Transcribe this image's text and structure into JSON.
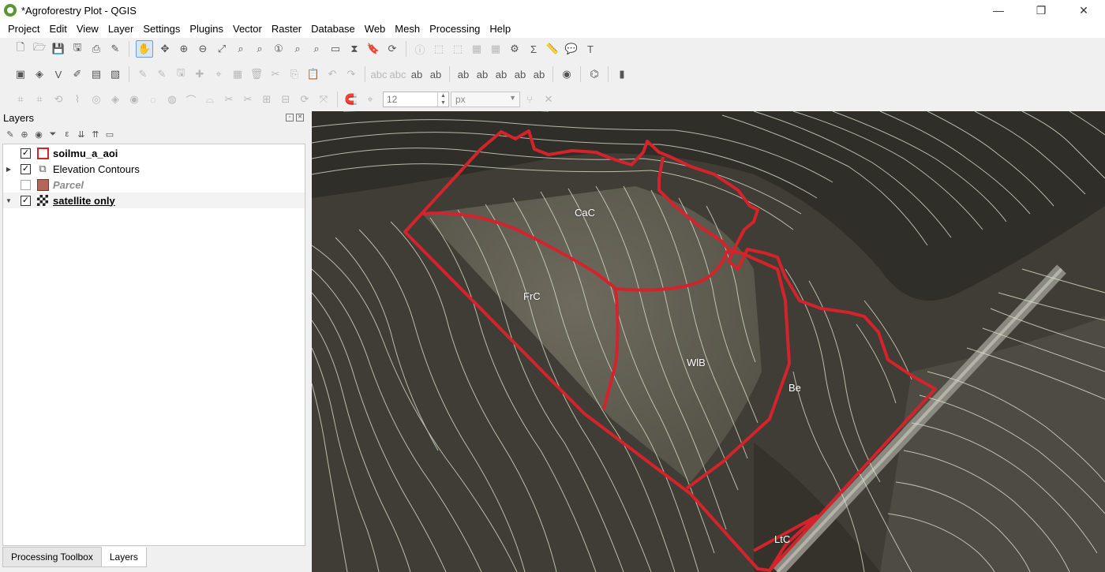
{
  "window": {
    "title": "*Agroforestry Plot - QGIS",
    "minimize": "—",
    "maximize": "❐",
    "close": "✕"
  },
  "menu": [
    "Project",
    "Edit",
    "View",
    "Layer",
    "Settings",
    "Plugins",
    "Vector",
    "Raster",
    "Database",
    "Web",
    "Mesh",
    "Processing",
    "Help"
  ],
  "snapping": {
    "tolerance": "12",
    "units": "px"
  },
  "layers_panel": {
    "title": "Layers",
    "layers": [
      {
        "name": "soilmu_a_aoi",
        "checked": true,
        "style": "bold",
        "symbol": "polygon-red-outline",
        "expandable": false
      },
      {
        "name": "Elevation Contours",
        "checked": true,
        "style": "normal",
        "symbol": "contour-lines",
        "expandable": true,
        "expanded": false
      },
      {
        "name": "Parcel",
        "checked": false,
        "style": "italic-dim",
        "symbol": "polygon-brown-fill",
        "expandable": false
      },
      {
        "name": "satellite only",
        "checked": true,
        "style": "bold-underline",
        "symbol": "raster-checker",
        "expandable": true,
        "expanded": true
      }
    ]
  },
  "bottom_tabs": [
    {
      "label": "Processing Toolbox",
      "active": false
    },
    {
      "label": "Layers",
      "active": true
    }
  ],
  "map": {
    "polygon_color": "#d4232b",
    "contour_color": "#d8ddc8",
    "labels": [
      "CaC",
      "FrC",
      "WlB",
      "Be",
      "LtC"
    ]
  }
}
